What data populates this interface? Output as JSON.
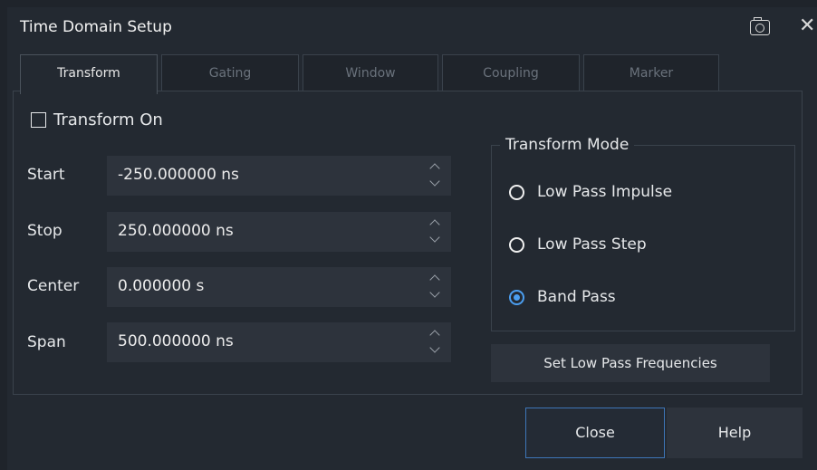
{
  "dialog": {
    "title": "Time Domain Setup",
    "camera_icon": "camera-icon",
    "close_icon": "close-icon"
  },
  "tabs": [
    {
      "label": "Transform",
      "active": true
    },
    {
      "label": "Gating",
      "active": false
    },
    {
      "label": "Window",
      "active": false
    },
    {
      "label": "Coupling",
      "active": false
    },
    {
      "label": "Marker",
      "active": false
    }
  ],
  "transform_on": {
    "label": "Transform On",
    "checked": false
  },
  "fields": {
    "start": {
      "label": "Start",
      "value": "-250.000000 ns"
    },
    "stop": {
      "label": "Stop",
      "value": "250.000000 ns"
    },
    "center": {
      "label": "Center",
      "value": "0.000000 s"
    },
    "span": {
      "label": "Span",
      "value": "500.000000 ns"
    }
  },
  "transform_mode": {
    "title": "Transform Mode",
    "options": [
      {
        "label": "Low Pass Impulse",
        "selected": false
      },
      {
        "label": "Low Pass Step",
        "selected": false
      },
      {
        "label": "Band Pass",
        "selected": true
      }
    ]
  },
  "buttons": {
    "set_low_pass": "Set Low Pass Frequencies",
    "close": "Close",
    "help": "Help"
  },
  "colors": {
    "background": "#232931",
    "field": "#2d333c",
    "accent": "#4b9ef0"
  }
}
